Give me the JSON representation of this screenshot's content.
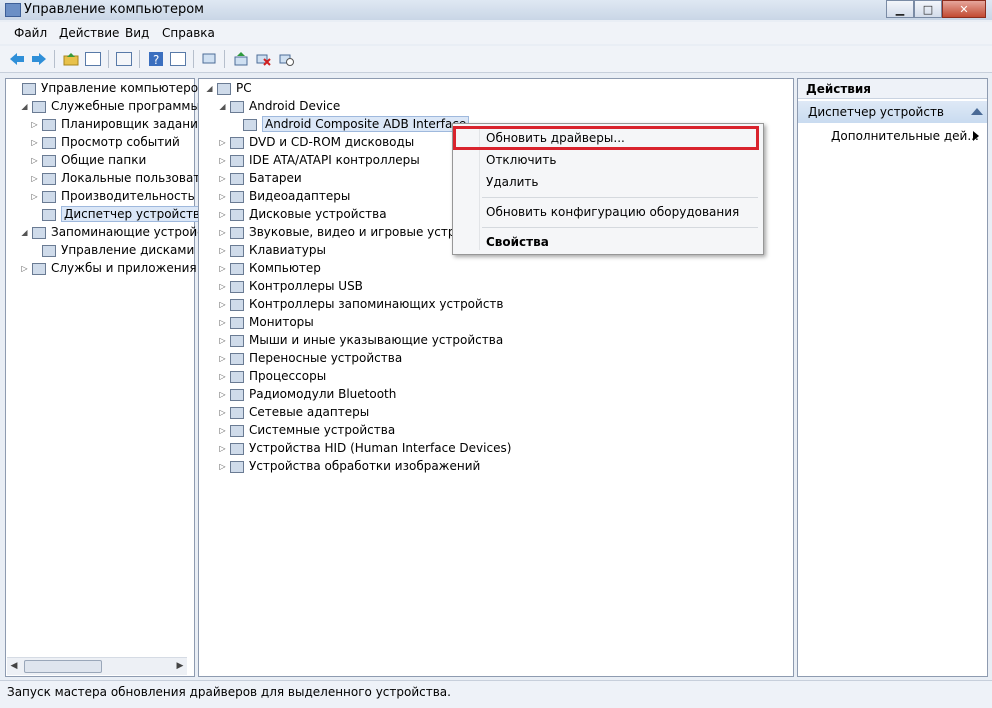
{
  "window": {
    "title": "Управление компьютером"
  },
  "menu": [
    "Файл",
    "Действие",
    "Вид",
    "Справка"
  ],
  "toolbar_icons": [
    "back-icon",
    "forward-icon",
    "up-folder-icon",
    "show-hide-tree-icon",
    "properties-icon",
    "help-icon",
    "show-hide-action-icon",
    "scan-hardware-icon",
    "update-driver-icon",
    "uninstall-icon",
    "disable-icon"
  ],
  "left_tree": [
    {
      "label": "Управление компьютером (л",
      "level": 0,
      "exp": "",
      "icon": "computer-management-icon"
    },
    {
      "label": "Служебные программы",
      "level": 1,
      "exp": "◢",
      "icon": "tools-icon"
    },
    {
      "label": "Планировщик заданий",
      "level": 2,
      "exp": "▷",
      "icon": "clock-icon"
    },
    {
      "label": "Просмотр событий",
      "level": 2,
      "exp": "▷",
      "icon": "event-viewer-icon"
    },
    {
      "label": "Общие папки",
      "level": 2,
      "exp": "▷",
      "icon": "shared-folder-icon"
    },
    {
      "label": "Локальные пользовате",
      "level": 2,
      "exp": "▷",
      "icon": "users-icon"
    },
    {
      "label": "Производительность",
      "level": 2,
      "exp": "▷",
      "icon": "performance-icon"
    },
    {
      "label": "Диспетчер устройств",
      "level": 2,
      "exp": "",
      "icon": "device-manager-icon",
      "selected": true
    },
    {
      "label": "Запоминающие устройст",
      "level": 1,
      "exp": "◢",
      "icon": "storage-icon"
    },
    {
      "label": "Управление дисками",
      "level": 2,
      "exp": "",
      "icon": "disk-management-icon"
    },
    {
      "label": "Службы и приложения",
      "level": 1,
      "exp": "▷",
      "icon": "services-icon"
    }
  ],
  "device_tree": [
    {
      "label": "PC",
      "level": 0,
      "exp": "◢",
      "icon": "computer-icon"
    },
    {
      "label": "Android Device",
      "level": 1,
      "exp": "◢",
      "icon": "android-device-icon"
    },
    {
      "label": "Android Composite ADB Interface",
      "level": 2,
      "exp": "",
      "icon": "adb-interface-icon",
      "selected": true
    },
    {
      "label": "DVD и CD-ROM дисководы",
      "level": 1,
      "exp": "▷",
      "icon": "dvd-drive-icon"
    },
    {
      "label": "IDE ATA/ATAPI контроллеры",
      "level": 1,
      "exp": "▷",
      "icon": "ide-controller-icon"
    },
    {
      "label": "Батареи",
      "level": 1,
      "exp": "▷",
      "icon": "battery-icon"
    },
    {
      "label": "Видеоадаптеры",
      "level": 1,
      "exp": "▷",
      "icon": "display-adapter-icon"
    },
    {
      "label": "Дисковые устройства",
      "level": 1,
      "exp": "▷",
      "icon": "disk-drive-icon"
    },
    {
      "label": "Звуковые, видео и игровые устрой",
      "level": 1,
      "exp": "▷",
      "icon": "sound-icon"
    },
    {
      "label": "Клавиатуры",
      "level": 1,
      "exp": "▷",
      "icon": "keyboard-icon"
    },
    {
      "label": "Компьютер",
      "level": 1,
      "exp": "▷",
      "icon": "computer-icon"
    },
    {
      "label": "Контроллеры USB",
      "level": 1,
      "exp": "▷",
      "icon": "usb-icon"
    },
    {
      "label": "Контроллеры запоминающих устройств",
      "level": 1,
      "exp": "▷",
      "icon": "storage-controller-icon"
    },
    {
      "label": "Мониторы",
      "level": 1,
      "exp": "▷",
      "icon": "monitor-icon"
    },
    {
      "label": "Мыши и иные указывающие устройства",
      "level": 1,
      "exp": "▷",
      "icon": "mouse-icon"
    },
    {
      "label": "Переносные устройства",
      "level": 1,
      "exp": "▷",
      "icon": "portable-device-icon"
    },
    {
      "label": "Процессоры",
      "level": 1,
      "exp": "▷",
      "icon": "processor-icon"
    },
    {
      "label": "Радиомодули Bluetooth",
      "level": 1,
      "exp": "▷",
      "icon": "bluetooth-icon"
    },
    {
      "label": "Сетевые адаптеры",
      "level": 1,
      "exp": "▷",
      "icon": "network-adapter-icon"
    },
    {
      "label": "Системные устройства",
      "level": 1,
      "exp": "▷",
      "icon": "system-device-icon"
    },
    {
      "label": "Устройства HID (Human Interface Devices)",
      "level": 1,
      "exp": "▷",
      "icon": "hid-icon"
    },
    {
      "label": "Устройства обработки изображений",
      "level": 1,
      "exp": "▷",
      "icon": "imaging-device-icon"
    }
  ],
  "context_menu": {
    "update_driver": "Обновить драйверы...",
    "disable": "Отключить",
    "uninstall": "Удалить",
    "scan_hardware": "Обновить конфигурацию оборудования",
    "properties": "Свойства",
    "highlight_color": "#d9232d"
  },
  "actions": {
    "header": "Действия",
    "section": "Диспетчер устройств",
    "more": "Дополнительные дей..."
  },
  "status": "Запуск мастера обновления драйверов для выделенного устройства."
}
